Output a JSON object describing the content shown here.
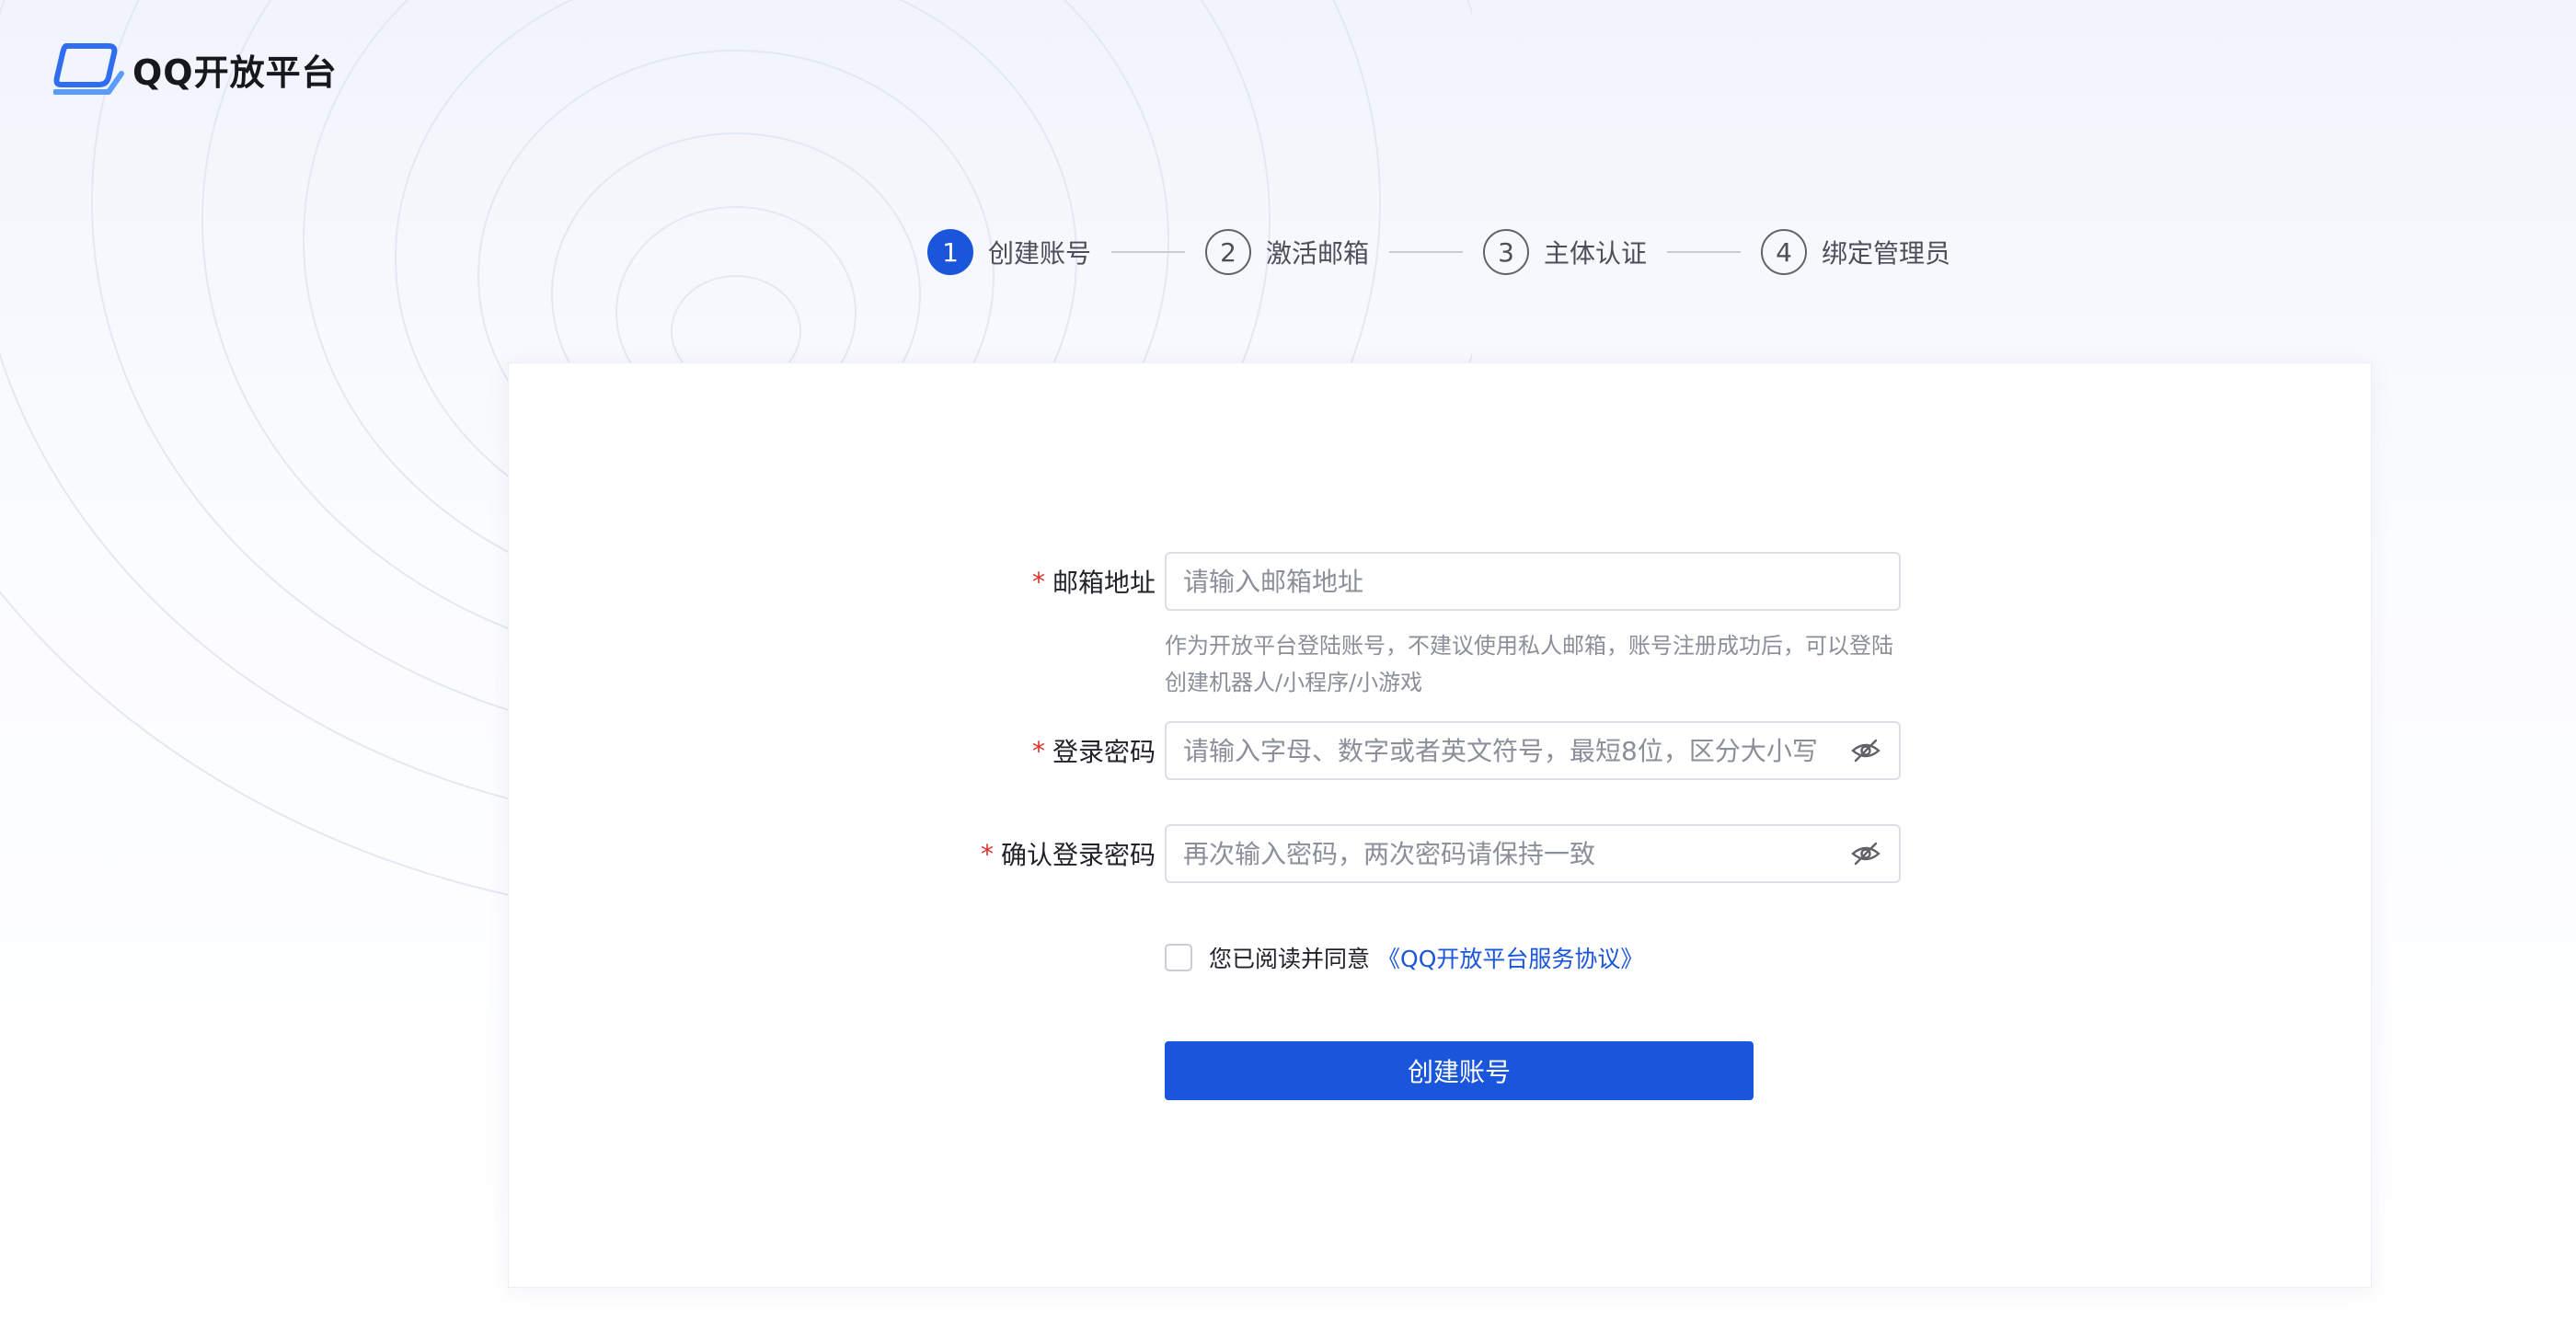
{
  "brand": {
    "logo_text": "QQ开放平台"
  },
  "steps": [
    {
      "number": "1",
      "label": "创建账号",
      "active": true
    },
    {
      "number": "2",
      "label": "激活邮箱",
      "active": false
    },
    {
      "number": "3",
      "label": "主体认证",
      "active": false
    },
    {
      "number": "4",
      "label": "绑定管理员",
      "active": false
    }
  ],
  "form": {
    "required_mark": "*",
    "email": {
      "label": "邮箱地址",
      "placeholder": "请输入邮箱地址",
      "value": "",
      "hint": "作为开放平台登陆账号，不建议使用私人邮箱，账号注册成功后，可以登陆创建机器人/小程序/小游戏"
    },
    "password": {
      "label": "登录密码",
      "placeholder": "请输入字母、数字或者英文符号，最短8位，区分大小写",
      "value": ""
    },
    "confirm_password": {
      "label": "确认登录密码",
      "placeholder": "再次输入密码，两次密码请保持一致",
      "value": ""
    },
    "agreement": {
      "checked": false,
      "text": "您已阅读并同意",
      "link_text": "《QQ开放平台服务协议》"
    },
    "submit_label": "创建账号"
  },
  "colors": {
    "primary": "#1a56db",
    "required": "#d93026",
    "placeholder": "#8a8f99"
  },
  "icons": {
    "password_toggle": "eye-off-icon",
    "confirm_toggle": "eye-off-icon",
    "logo": "qq-open-platform-logo-icon"
  }
}
